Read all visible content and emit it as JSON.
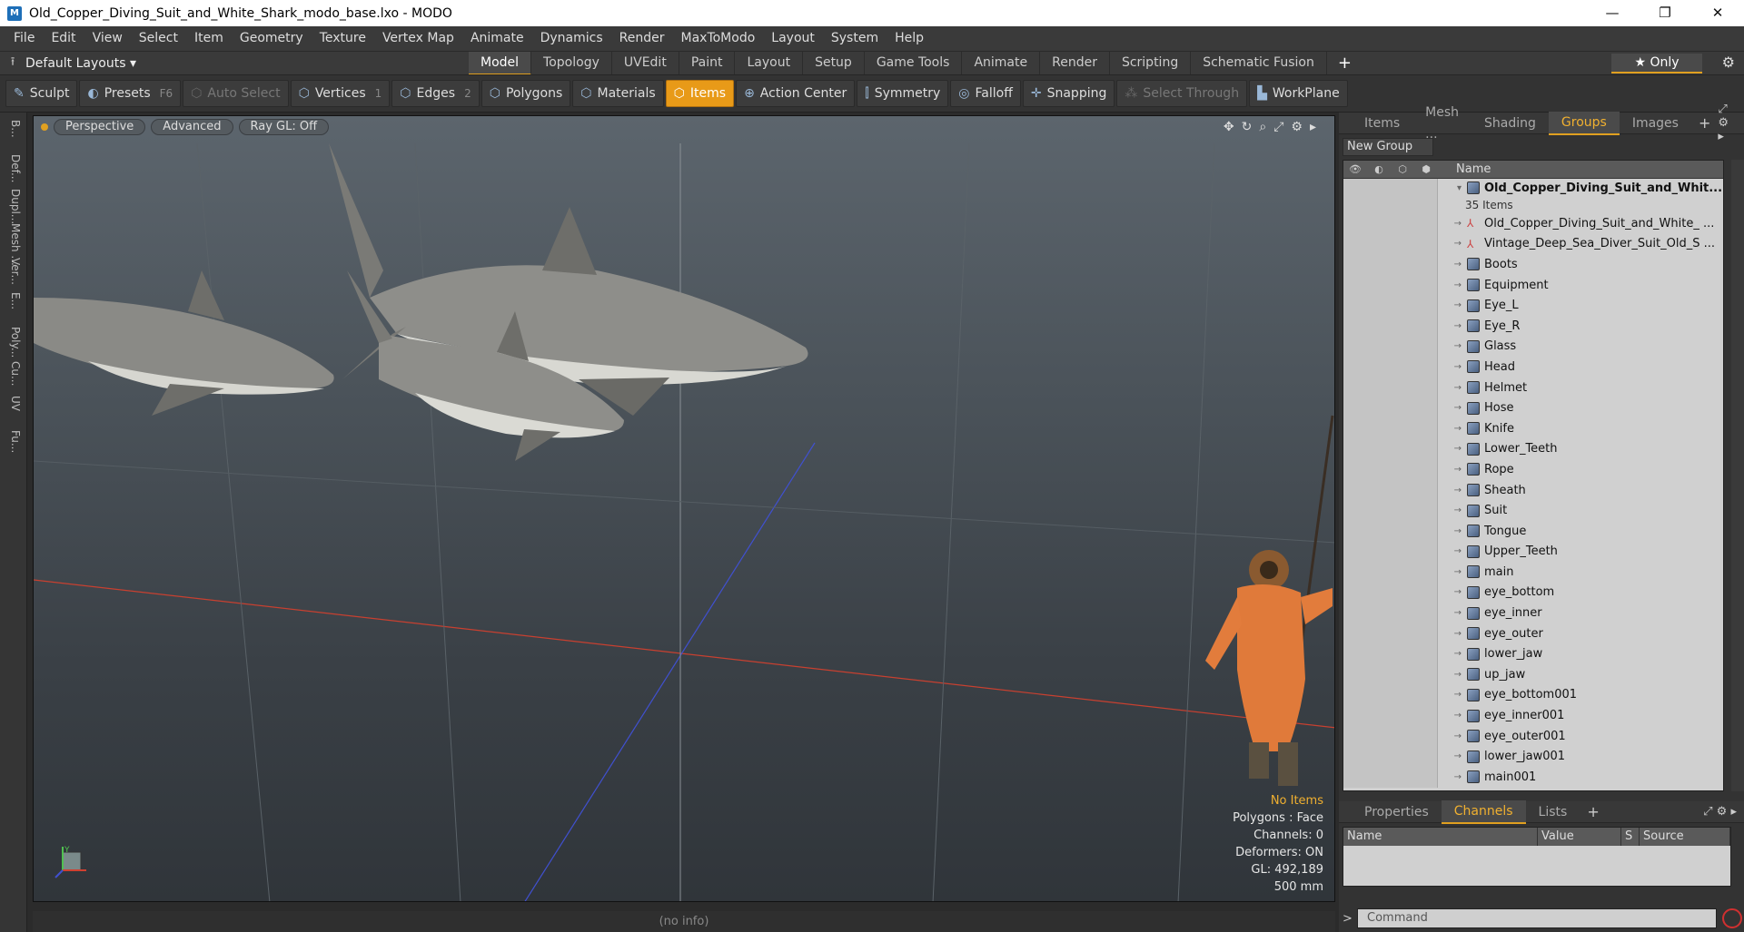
{
  "window": {
    "title": "Old_Copper_Diving_Suit_and_White_Shark_modo_base.lxo - MODO",
    "minimize": "—",
    "maximize": "❐",
    "close": "✕"
  },
  "menu": [
    "File",
    "Edit",
    "View",
    "Select",
    "Item",
    "Geometry",
    "Texture",
    "Vertex Map",
    "Animate",
    "Dynamics",
    "Render",
    "MaxToModo",
    "Layout",
    "System",
    "Help"
  ],
  "layoutbar": {
    "default_layouts": "Default Layouts ▾",
    "tabs": [
      "Model",
      "Topology",
      "UVEdit",
      "Paint",
      "Layout",
      "Setup",
      "Game Tools",
      "Animate",
      "Render",
      "Scripting",
      "Schematic Fusion"
    ],
    "active_tab": "Model",
    "plus": "+",
    "only": "★ Only"
  },
  "toolbar": [
    {
      "label": "Sculpt",
      "icon": "✎",
      "key": "",
      "state": "normal"
    },
    {
      "label": "Presets",
      "icon": "◐",
      "key": "F6",
      "state": "normal"
    },
    {
      "label": "Auto Select",
      "icon": "⬡",
      "key": "",
      "state": "dim"
    },
    {
      "label": "Vertices",
      "icon": "⬡",
      "key": "1",
      "state": "normal"
    },
    {
      "label": "Edges",
      "icon": "⬡",
      "key": "2",
      "state": "normal"
    },
    {
      "label": "Polygons",
      "icon": "⬡",
      "key": "",
      "state": "normal"
    },
    {
      "label": "Materials",
      "icon": "⬡",
      "key": "",
      "state": "normal"
    },
    {
      "label": "Items",
      "icon": "⬡",
      "key": "",
      "state": "active"
    },
    {
      "label": "Action Center",
      "icon": "⊕",
      "key": "",
      "state": "normal"
    },
    {
      "label": "Symmetry",
      "icon": "⫿",
      "key": "",
      "state": "normal"
    },
    {
      "label": "Falloff",
      "icon": "◎",
      "key": "",
      "state": "normal"
    },
    {
      "label": "Snapping",
      "icon": "✛",
      "key": "",
      "state": "normal"
    },
    {
      "label": "Select Through",
      "icon": "⁂",
      "key": "",
      "state": "dim"
    },
    {
      "label": "WorkPlane",
      "icon": "▙",
      "key": "",
      "state": "normal"
    }
  ],
  "left_strip": [
    "B...",
    "Def...",
    "Dupl...",
    "Mesh ...",
    "Ver...",
    "E...",
    "Poly...",
    "Cu...",
    "UV",
    "Fu..."
  ],
  "viewport": {
    "perspective": "Perspective",
    "advanced": "Advanced",
    "raygl": "Ray GL: Off",
    "hud": {
      "no_items": "No Items",
      "polygons": "Polygons : Face",
      "channels": "Channels: 0",
      "deformers": "Deformers: ON",
      "gl": "GL: 492,189",
      "scale": "500 mm"
    },
    "axis_y": "Y"
  },
  "statusbar": "(no info)",
  "right_panel": {
    "tabs": [
      "Items",
      "Mesh ...",
      "Shading",
      "Groups",
      "Images"
    ],
    "active_tab": "Groups",
    "new_group": "New Group",
    "tree_header": "Name",
    "root": "Old_Copper_Diving_Suit_and_Whit...",
    "root_count": "35 Items",
    "locators": [
      "Old_Copper_Diving_Suit_and_White_ ...",
      "Vintage_Deep_Sea_Diver_Suit_Old_S ..."
    ],
    "meshes": [
      "Boots",
      "Equipment",
      "Eye_L",
      "Eye_R",
      "Glass",
      "Head",
      "Helmet",
      "Hose",
      "Knife",
      "Lower_Teeth",
      "Rope",
      "Sheath",
      "Suit",
      "Tongue",
      "Upper_Teeth",
      "main",
      "eye_bottom",
      "eye_inner",
      "eye_outer",
      "lower_jaw",
      "up_jaw",
      "eye_bottom001",
      "eye_inner001",
      "eye_outer001",
      "lower_jaw001",
      "main001"
    ],
    "bottom_tabs": [
      "Properties",
      "Channels",
      "Lists"
    ],
    "bottom_active": "Channels",
    "channel_cols": [
      "Name",
      "Value",
      "S",
      "Source"
    ],
    "command_placeholder": "Command",
    "prompt": ">"
  },
  "colors": {
    "accent": "#e0a020",
    "active_btn": "#e89a18",
    "x_axis": "#d04030",
    "z_axis": "#4050d0"
  }
}
